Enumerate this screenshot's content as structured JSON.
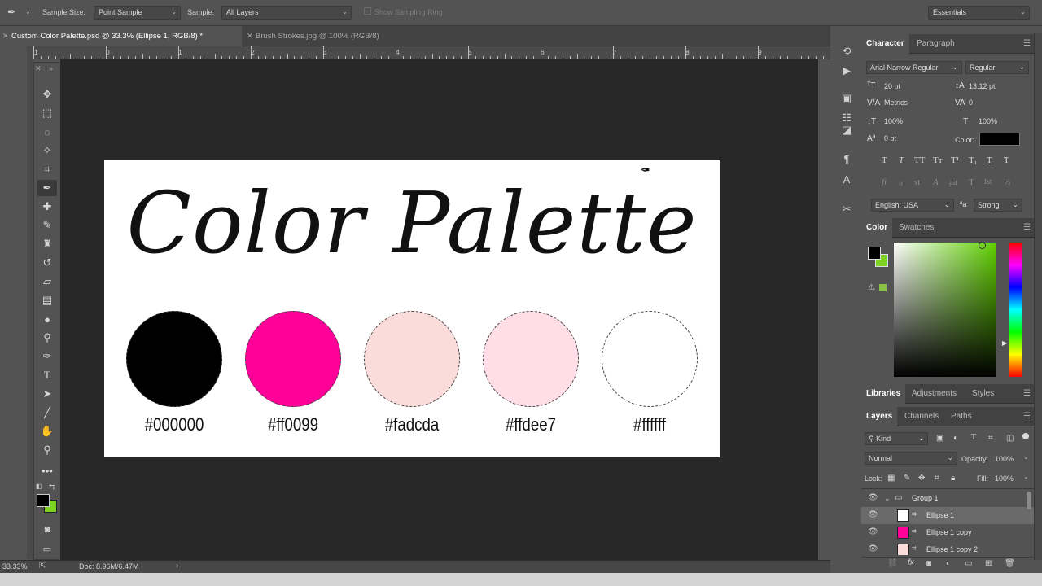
{
  "options_bar": {
    "sample_size_label": "Sample Size:",
    "sample_size_value": "Point Sample",
    "sample_label": "Sample:",
    "sample_value": "All Layers",
    "show_sampling_ring": "Show Sampling Ring",
    "workspace": "Essentials"
  },
  "tabs": [
    {
      "label": "Custom Color Palette.psd @ 33.3% (Ellipse 1, RGB/8) *"
    },
    {
      "label": "Brush Strokes.jpg @ 100% (RGB/8)"
    }
  ],
  "ruler_numbers": [
    "1",
    "0",
    "1",
    "2",
    "3",
    "4",
    "5",
    "6",
    "7",
    "8",
    "9"
  ],
  "document": {
    "title": "Color Palette",
    "swatches": [
      {
        "label": "#000000",
        "color": "#000000"
      },
      {
        "label": "#ff0099",
        "color": "#ff0099"
      },
      {
        "label": "#fadcda",
        "color": "#fadcda"
      },
      {
        "label": "#ffdee7",
        "color": "#ffdee7"
      },
      {
        "label": "#ffffff",
        "color": "#ffffff"
      }
    ]
  },
  "status": {
    "zoom": "33.33%",
    "doc": "Doc: 8.96M/6.47M"
  },
  "character_panel": {
    "tab_character": "Character",
    "tab_paragraph": "Paragraph",
    "font_family": "Arial Narrow Regular",
    "font_style": "Regular",
    "font_size": "20 pt",
    "leading": "13.12 pt",
    "kerning": "Metrics",
    "tracking": "0",
    "vertical_scale": "100%",
    "horizontal_scale": "100%",
    "baseline_shift": "0 pt",
    "color_label": "Color:",
    "language": "English: USA",
    "antialias": "Strong",
    "style_buttons": [
      "T",
      "T",
      "TT",
      "Tт",
      "T¹",
      "T₁",
      "T",
      "T"
    ],
    "opentype_buttons": [
      "fi",
      "ℴ",
      "st",
      "A",
      "aa",
      "T",
      "1st",
      "½"
    ]
  },
  "color_panel": {
    "tab_color": "Color",
    "tab_swatches": "Swatches",
    "foreground": "#000000",
    "background": "#7ed321",
    "hue_color": "#5fd000"
  },
  "libraries_panel": {
    "tab_libraries": "Libraries",
    "tab_adjustments": "Adjustments",
    "tab_styles": "Styles"
  },
  "layers_panel": {
    "tab_layers": "Layers",
    "tab_channels": "Channels",
    "tab_paths": "Paths",
    "filter_kind": "Kind",
    "blend_mode": "Normal",
    "opacity_label": "Opacity:",
    "opacity_value": "100%",
    "lock_label": "Lock:",
    "fill_label": "Fill:",
    "fill_value": "100%",
    "layers": [
      {
        "name": "Group 1"
      },
      {
        "name": "Ellipse 1"
      },
      {
        "name": "Ellipse 1 copy"
      },
      {
        "name": "Ellipse 1 copy 2"
      }
    ]
  }
}
